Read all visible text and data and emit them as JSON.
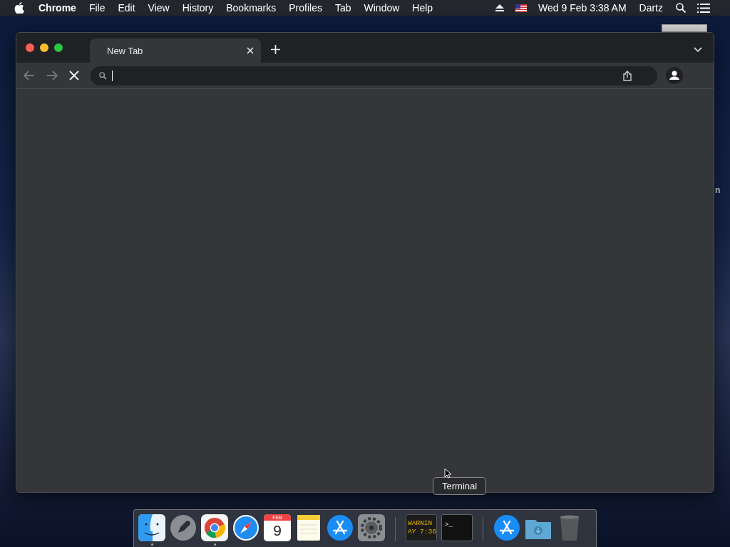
{
  "menu_bar": {
    "app": "Chrome",
    "items": [
      "File",
      "Edit",
      "View",
      "History",
      "Bookmarks",
      "Profiles",
      "Tab",
      "Window",
      "Help"
    ],
    "clock": "Wed 9 Feb  3:38 AM",
    "user": "Dartz"
  },
  "desktop": {
    "icon_label": "n"
  },
  "browser": {
    "tabs": [
      {
        "label": "New Tab",
        "selected": true
      }
    ],
    "loading": true
  },
  "dock": {
    "tooltip": "Terminal",
    "apps": [
      {
        "kind": "finder",
        "running": true
      },
      {
        "kind": "launchpad",
        "running": false
      },
      {
        "kind": "chrome",
        "running": true
      },
      {
        "kind": "safari",
        "running": false
      },
      {
        "kind": "calendar",
        "running": false,
        "month": "FEB",
        "day": "9"
      },
      {
        "kind": "notes",
        "running": false
      },
      {
        "kind": "appstore",
        "running": false
      },
      {
        "kind": "settings",
        "running": false
      }
    ],
    "recent": [
      {
        "kind": "console",
        "running": false,
        "lines": [
          "WARNIN",
          "AY 7:36"
        ]
      },
      {
        "kind": "terminal",
        "running": false,
        "prompt": ">_"
      }
    ],
    "others": [
      {
        "kind": "appstore",
        "running": false
      },
      {
        "kind": "downloads",
        "running": false
      },
      {
        "kind": "trash",
        "running": false
      }
    ]
  }
}
